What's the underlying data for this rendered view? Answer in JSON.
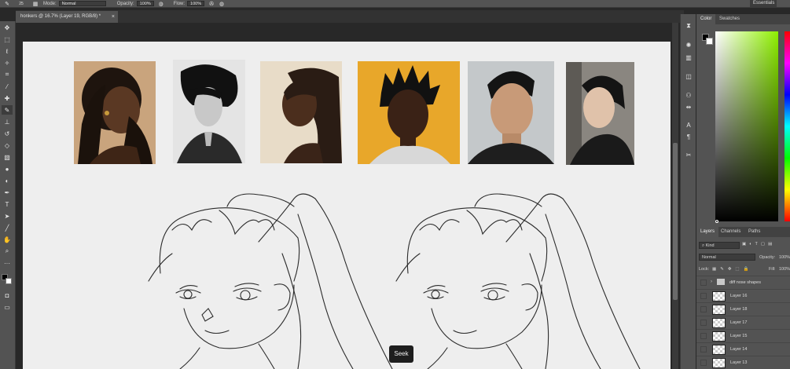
{
  "options_bar": {
    "brush_size": "25",
    "mode_label": "Mode:",
    "mode_value": "Normal",
    "opacity_label": "Opacity:",
    "opacity_value": "100%",
    "flow_label": "Flow:",
    "flow_value": "100%",
    "workspace": "Essentials"
  },
  "document": {
    "tab_title": "honkers @ 16.7% (Layer 19, RGB/8) *",
    "close_glyph": "×"
  },
  "tools": [
    "move-tool",
    "marquee-tool",
    "lasso-tool",
    "quick-select-tool",
    "crop-tool",
    "eyedropper-tool",
    "healing-tool",
    "brush-tool",
    "stamp-tool",
    "history-brush-tool",
    "eraser-tool",
    "gradient-tool",
    "blur-tool",
    "dodge-tool",
    "pen-tool",
    "type-tool",
    "path-select-tool",
    "line-tool",
    "hand-tool",
    "zoom-tool",
    "more-tools",
    "color-swatch",
    "quick-mask",
    "screen-mode"
  ],
  "color_panel": {
    "tabs": [
      "Color",
      "Swatches"
    ],
    "active_tab": "Color",
    "foreground_color": "#000000",
    "background_color": "#ffffff",
    "hue_color": "#8ef000"
  },
  "layers_panel": {
    "tabs": [
      "Layers",
      "Channels",
      "Paths"
    ],
    "filter_label": "Kind",
    "blend_mode": "Normal",
    "opacity_label": "Opacity:",
    "opacity_value": "100%",
    "lock_label": "Lock:",
    "fill_label": "Fill:",
    "fill_value": "100%",
    "layers": [
      {
        "name": "diff nose shapes",
        "type": "group"
      },
      {
        "name": "Layer 16",
        "type": "layer"
      },
      {
        "name": "Layer 18",
        "type": "layer"
      },
      {
        "name": "Layer 17",
        "type": "layer"
      },
      {
        "name": "Layer 15",
        "type": "layer"
      },
      {
        "name": "Layer 14",
        "type": "layer"
      },
      {
        "name": "Layer 13",
        "type": "layer"
      }
    ]
  },
  "video_overlay": {
    "seek_label": "Seek"
  }
}
